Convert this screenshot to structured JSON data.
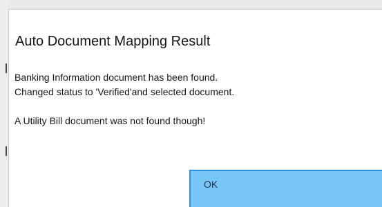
{
  "dialog": {
    "title": "Auto Document Mapping Result",
    "messages": [
      "Banking Information document has been found.",
      "Changed status to 'Verified'and selected document.",
      "A Utility Bill document was not found though!"
    ],
    "ok_label": "OK"
  },
  "colors": {
    "button_fill": "#78c5f7",
    "button_border": "#2a93e0",
    "text": "#161616"
  }
}
